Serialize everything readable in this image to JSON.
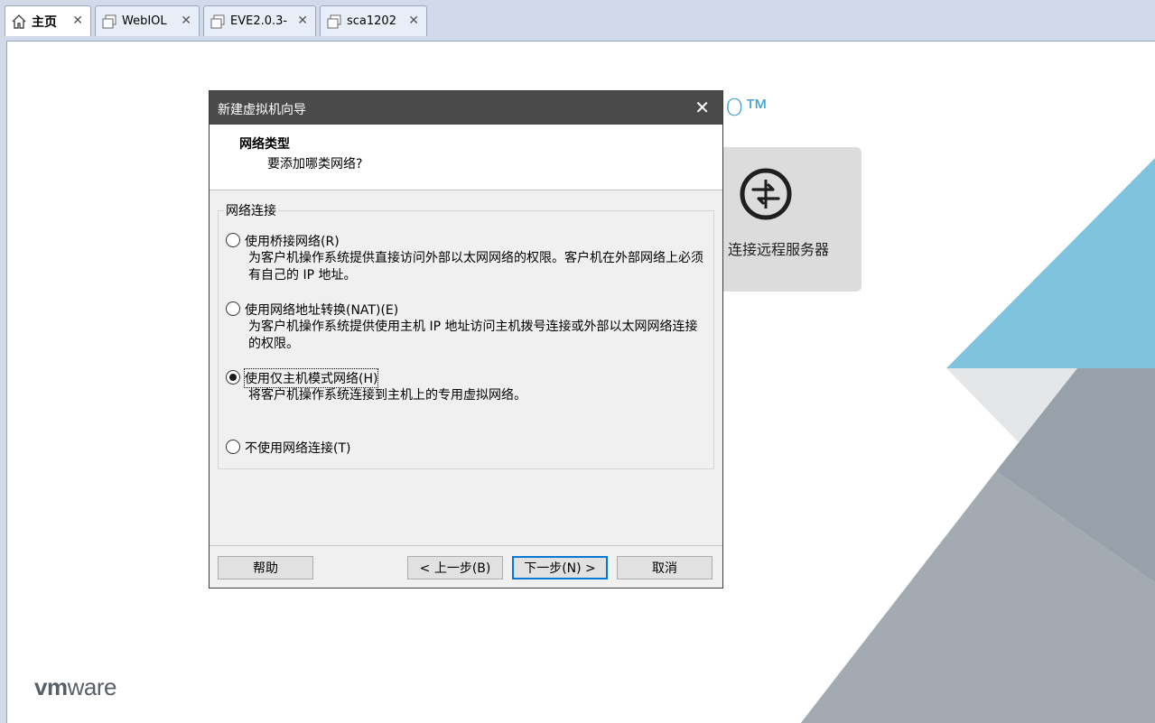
{
  "tabs": [
    {
      "label": "主页",
      "icon": "home-icon",
      "active": true
    },
    {
      "label": "WebIOL",
      "icon": "vm-icon",
      "active": false
    },
    {
      "label": "EVE2.0.3-",
      "icon": "vm-icon",
      "active": false
    },
    {
      "label": "sca1202",
      "icon": "vm-icon",
      "active": false
    }
  ],
  "home": {
    "remote_server_label": "连接远程服务器",
    "tm": "O™",
    "logo": {
      "vm": "vm",
      "ware": "ware"
    }
  },
  "dialog": {
    "title": "新建虚拟机向导",
    "close": "✕",
    "header": {
      "title": "网络类型",
      "subtitle": "要添加哪类网络?"
    },
    "group_label": "网络连接",
    "options": [
      {
        "label": "使用桥接网络(R)",
        "desc": "为客户机操作系统提供直接访问外部以太网网络的权限。客户机在外部网络上必须有自己的 IP 地址。",
        "checked": false
      },
      {
        "label": "使用网络地址转换(NAT)(E)",
        "desc": "为客户机操作系统提供使用主机 IP 地址访问主机拨号连接或外部以太网网络连接的权限。",
        "checked": false
      },
      {
        "label": "使用仅主机模式网络(H)",
        "desc": "将客户机操作系统连接到主机上的专用虚拟网络。",
        "checked": true
      },
      {
        "label": "不使用网络连接(T)",
        "desc": "",
        "checked": false
      }
    ],
    "buttons": {
      "help": "帮助",
      "back": "< 上一步(B)",
      "next": "下一步(N) >",
      "cancel": "取消"
    }
  },
  "colors": {
    "accent": "#0078d7",
    "vmware_blue": "#3aa0d0",
    "titlebar": "#4a4a4a"
  }
}
